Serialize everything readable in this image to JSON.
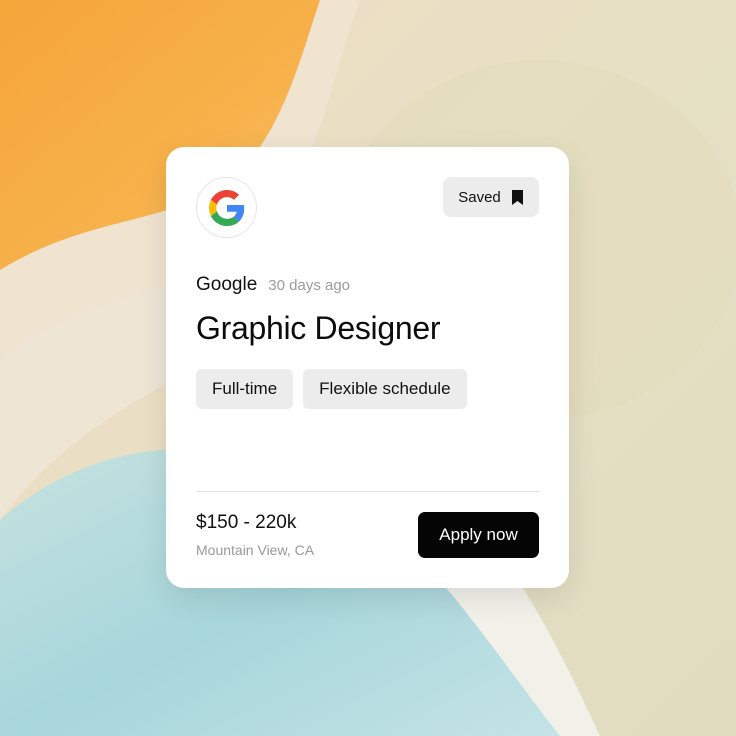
{
  "job_card": {
    "company_logo_icon": "google-g-icon",
    "saved_label": "Saved",
    "saved_icon": "bookmark-icon",
    "company": "Google",
    "posted": "30 days ago",
    "title": "Graphic Designer",
    "tags": [
      "Full-time",
      "Flexible schedule"
    ],
    "salary": "$150 - 220k",
    "location": "Mountain View, CA",
    "apply_label": "Apply now"
  },
  "colors": {
    "card_bg": "#ffffff",
    "button_dark": "#050505",
    "chip_bg": "#ececec",
    "muted_text": "#9a9a9a",
    "bg_orange": "#f2a93b",
    "bg_teal": "#a9d8dc",
    "bg_cream": "#e6e1c7"
  }
}
